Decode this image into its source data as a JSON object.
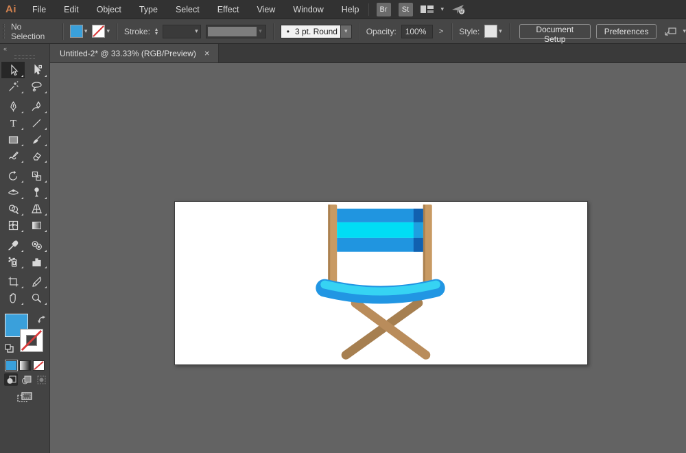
{
  "glyphs": {
    "chevron_down": "▾",
    "stepper_up": "▴",
    "stepper_down": "▾",
    "close": "×",
    "collapse": "«",
    "bullet": "•",
    "arrow_right": ">"
  },
  "menubar": {
    "logo": "Ai",
    "items": [
      "File",
      "Edit",
      "Object",
      "Type",
      "Select",
      "Effect",
      "View",
      "Window",
      "Help"
    ],
    "bridge_label": "Br",
    "stock_label": "St",
    "right_icons": [
      "workspace-switcher-icon",
      "chevron-down-icon",
      "share-icon"
    ]
  },
  "controlbar": {
    "selection_status": "No Selection",
    "fill_swatch": "#3aa0db",
    "stroke_swatch": "none",
    "stroke_label": "Stroke:",
    "brush_name": "3 pt. Round",
    "opacity_label": "Opacity:",
    "opacity_value": "100%",
    "style_label": "Style:",
    "document_setup_label": "Document Setup",
    "preferences_label": "Preferences"
  },
  "tab": {
    "title": "Untitled-2* @ 33.33% (RGB/Preview)"
  },
  "toolbar": {
    "selected_tool": "selection",
    "tools": [
      "selection",
      "direct-selection",
      "magic-wand",
      "lasso",
      "pen",
      "curvature",
      "type",
      "line-segment",
      "rectangle",
      "paintbrush",
      "shaper",
      "eraser",
      "rotate",
      "scale",
      "width",
      "puppet-warp",
      "shape-builder",
      "perspective-grid",
      "mesh",
      "gradient",
      "eyedropper",
      "blend",
      "symbol-sprayer",
      "column-graph",
      "artboard",
      "slice",
      "hand",
      "zoom"
    ],
    "fill_color": "#3aa0db",
    "stroke_color": "none",
    "active_drawing_mode": "draw-normal"
  },
  "colors": {
    "accent_fill_blue": "#3aa0db",
    "none_red": "#d93a3a",
    "canvas_gray": "#636363"
  },
  "chair": {
    "wood_post": "#c89a63",
    "wood_post_edge": "#ab8150",
    "wood_leg_front": "#b98c5b",
    "wood_leg_back": "#a67f50",
    "stripe_blue": "#2095e0",
    "stripe_cyan": "#00ddf5",
    "stripe_shadow_dark": "#1161b0",
    "stripe_shadow_mid": "#1e9fe0",
    "seat_blue": "#2196e3",
    "seat_cyan": "#36d3f3"
  }
}
